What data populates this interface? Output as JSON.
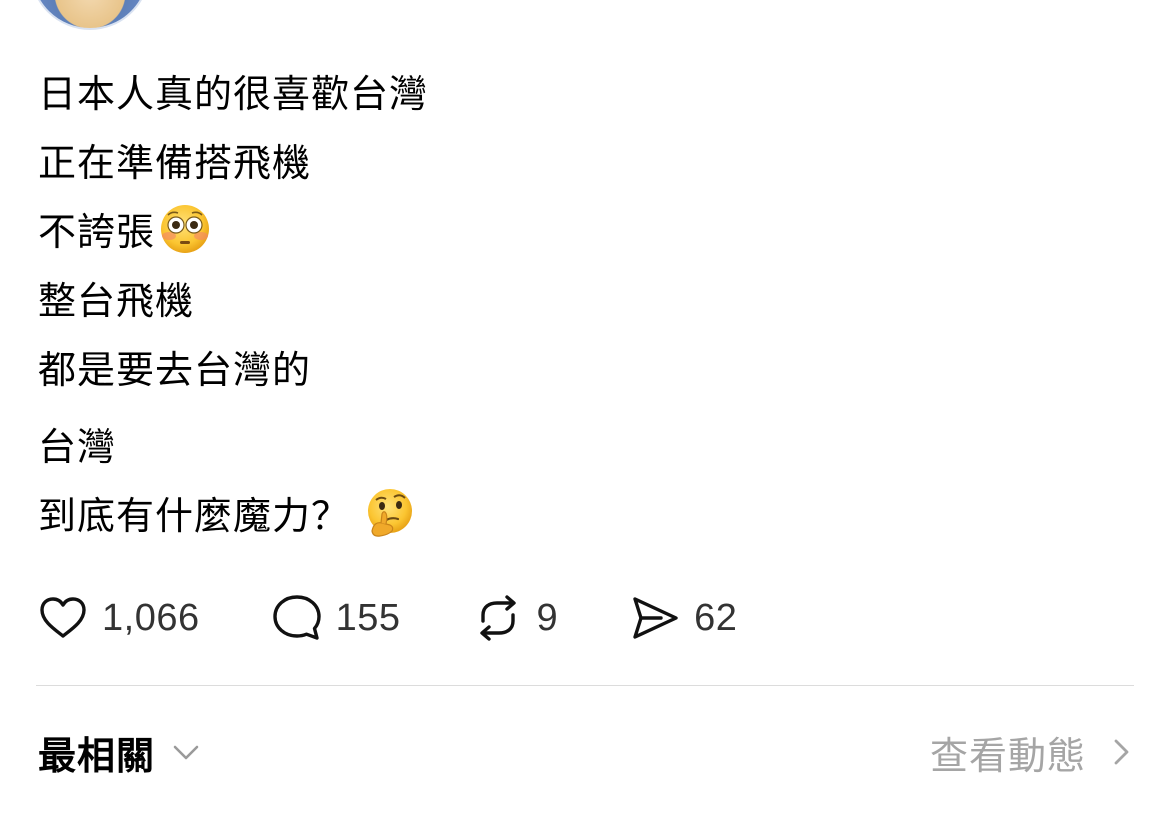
{
  "post": {
    "lines": [
      "日本人真的很喜歡台灣",
      "正在準備搭飛機",
      "不誇張",
      "整台飛機",
      "都是要去台灣的",
      "台灣",
      "到底有什麼魔力？"
    ]
  },
  "actions": {
    "likes": "1,066",
    "comments": "155",
    "reposts": "9",
    "shares": "62"
  },
  "footer": {
    "sort_label": "最相關",
    "activity_label": "查看動態"
  },
  "icons": {
    "flushed_face": "flushed-face-emoji",
    "thinking_face": "thinking-face-emoji",
    "like": "heart-icon",
    "comment": "speech-bubble-icon",
    "repost": "repost-icon",
    "share": "send-icon",
    "sort_toggle": "chevron-down-icon",
    "activity_arrow": "chevron-right-icon"
  },
  "colors": {
    "text": "#000000",
    "count_text": "#333333",
    "muted_link": "#a5a5a5",
    "divider": "#dcdcdc"
  }
}
